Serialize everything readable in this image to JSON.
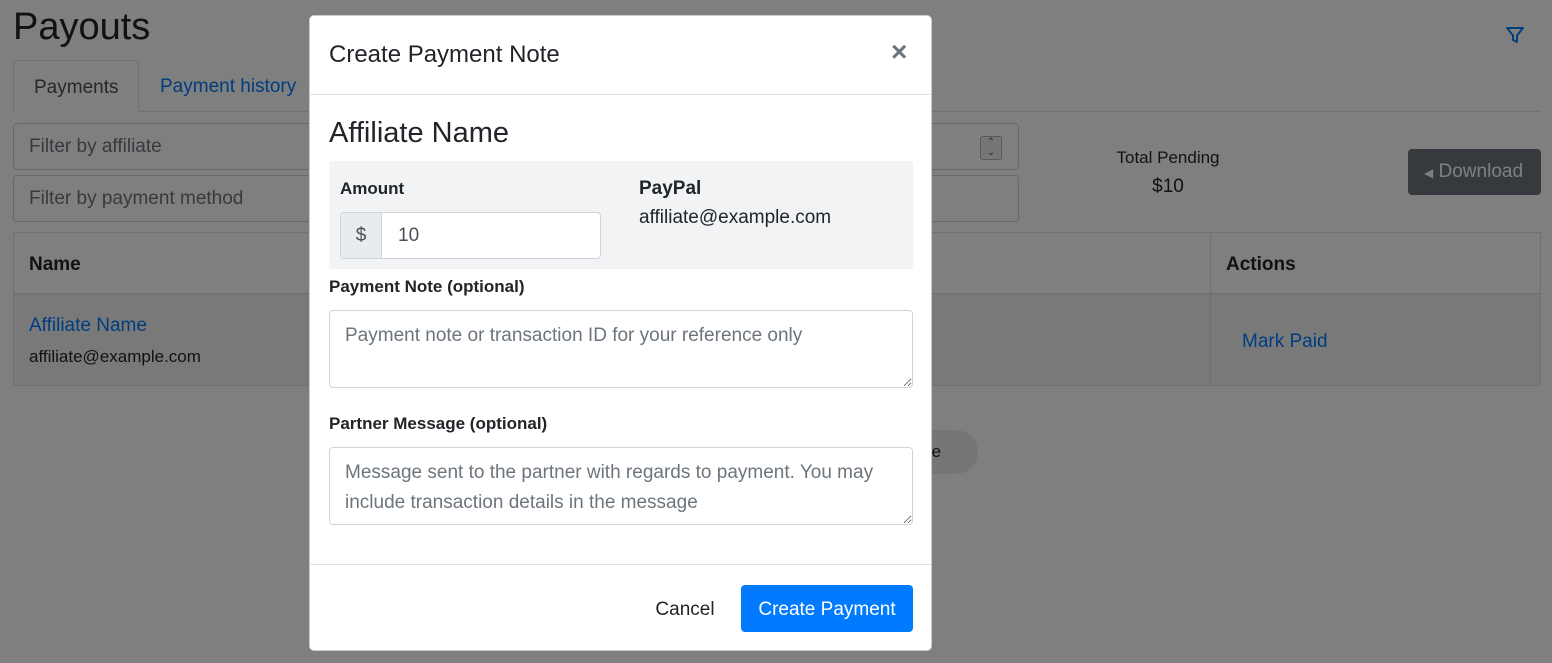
{
  "page": {
    "title": "Payouts",
    "filter_icon": "filter-icon",
    "tabs": [
      {
        "label": "Payments",
        "active": true
      },
      {
        "label": "Payment history",
        "active": false
      }
    ],
    "filters": {
      "affiliate_placeholder": "Filter by affiliate",
      "method_placeholder": "Filter by payment method"
    },
    "total_pending": {
      "label": "Total Pending",
      "value": "$10"
    },
    "download_label": "Download",
    "table": {
      "headers": [
        "Name",
        "Actions"
      ],
      "rows": [
        {
          "name": "Affiliate Name",
          "email": "affiliate@example.com",
          "action": "Mark Paid"
        }
      ]
    },
    "load_more_partial": "re"
  },
  "modal": {
    "title": "Create Payment Note",
    "close_symbol": "×",
    "affiliate_name": "Affiliate Name",
    "amount_label": "Amount",
    "currency_prefix": "$",
    "amount_value": "10",
    "method_label": "PayPal",
    "method_email": "affiliate@example.com",
    "note_label": "Payment Note (optional)",
    "note_placeholder": "Payment note or transaction ID for your reference only",
    "message_label": "Partner Message (optional)",
    "message_placeholder": "Message sent to the partner with regards to payment. You may include transaction details in the message",
    "cancel_label": "Cancel",
    "submit_label": "Create Payment"
  },
  "colors": {
    "primary": "#007bff",
    "secondary": "#6c757d",
    "backdrop": "rgba(0,0,0,0.5)"
  }
}
